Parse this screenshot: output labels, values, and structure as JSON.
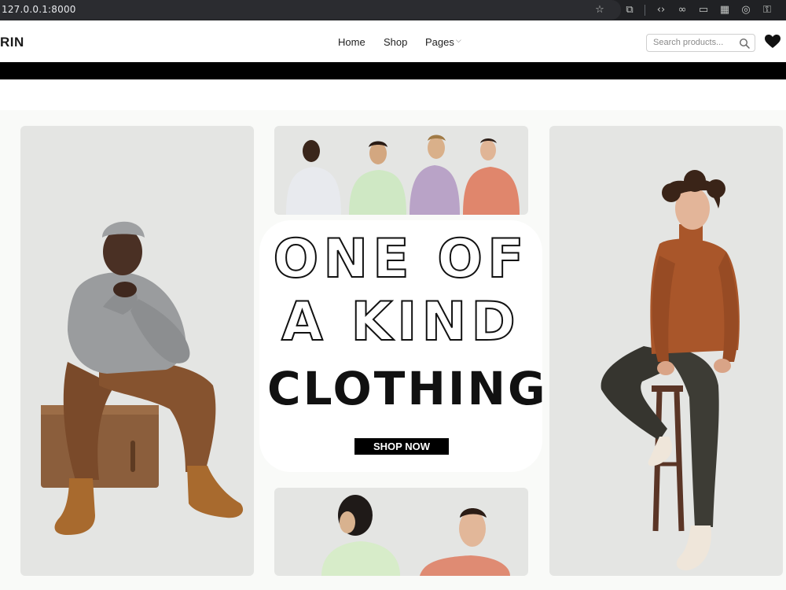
{
  "browser": {
    "url": "127.0.0.1:8000",
    "icons": [
      "star-icon",
      "extension-icon",
      "code-icon",
      "link-icon",
      "cast-icon",
      "qr-code-icon",
      "screenshot-icon",
      "key-icon"
    ]
  },
  "header": {
    "logo": "RIN",
    "nav": {
      "home": "Home",
      "shop": "Shop",
      "pages": "Pages"
    },
    "search": {
      "placeholder": "Search products..."
    }
  },
  "hero": {
    "line1": "ONE OF",
    "line2": "A KIND",
    "line3": "CLOTHING",
    "cta": "SHOP NOW"
  },
  "colors": {
    "accent": "#000000",
    "panel_bg": "#e4e5e3",
    "hero_bg": "#f9faf8"
  }
}
